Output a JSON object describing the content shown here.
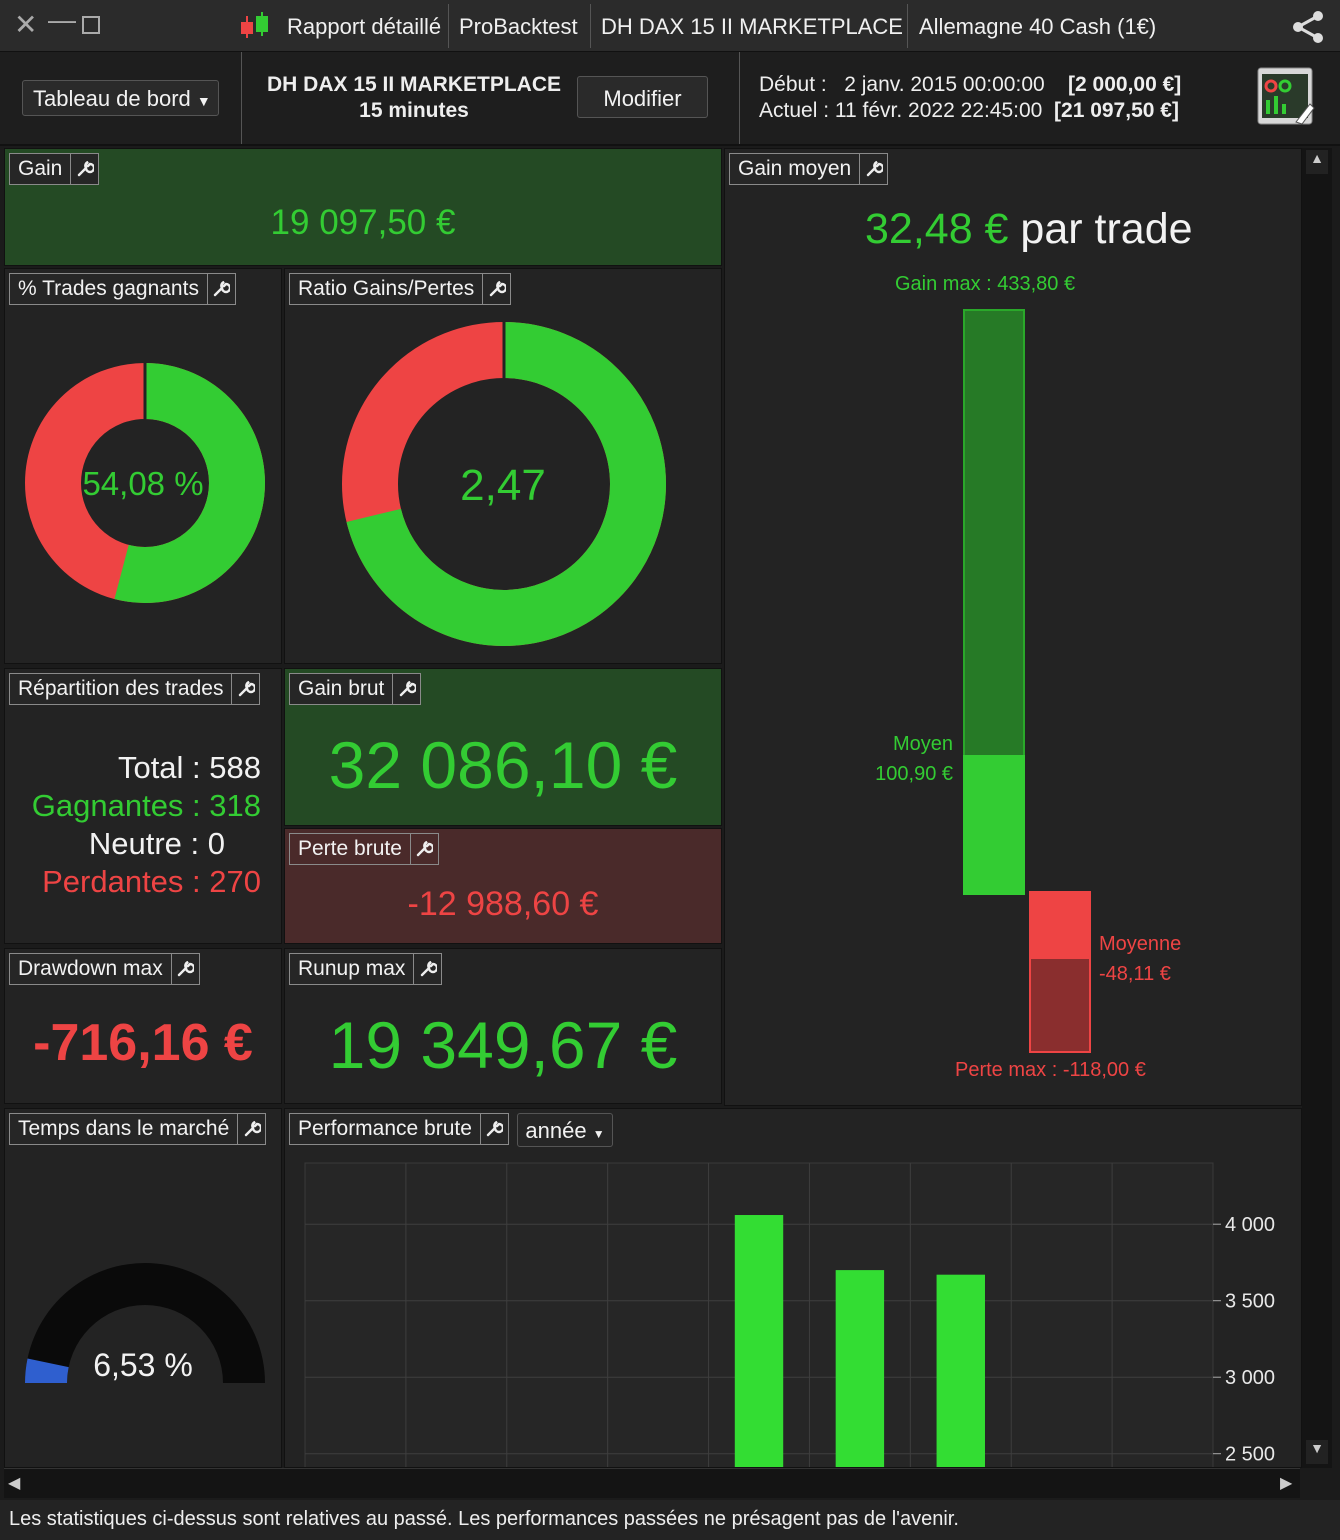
{
  "titlebar": {
    "close": "✕",
    "minimize": "—",
    "maximize": "☐",
    "tabs": [
      "Rapport détaillé",
      "ProBacktest",
      "DH DAX 15 II MARKETPLACE",
      "Allemagne 40 Cash (1€)"
    ]
  },
  "header": {
    "dashboard_select": "Tableau de bord",
    "strategy_name": "DH DAX 15 II MARKETPLACE",
    "timeframe": "15 minutes",
    "modify_label": "Modifier",
    "start_label": "Début :",
    "start_date": "2 janv. 2015 00:00:00",
    "start_capital": "[2 000,00 €]",
    "current_label": "Actuel :",
    "current_date": "11 févr. 2022 22:45:00",
    "current_capital": "[21 097,50 €]"
  },
  "panels": {
    "gain": {
      "title": "Gain",
      "value": "19 097,50 €"
    },
    "win_pct": {
      "title": "% Trades gagnants",
      "value": "54,08 %",
      "fraction": 0.5408
    },
    "ratio": {
      "title": "Ratio Gains/Pertes",
      "value": "2,47",
      "gain_fraction": 0.712
    },
    "avg_gain": {
      "title": "Gain moyen",
      "value": "32,48 €",
      "suffix": "par trade",
      "max_gain": "Gain max : 433,80 €",
      "avg_win_label": "Moyen",
      "avg_win_value": "100,90 €",
      "avg_loss_label": "Moyenne",
      "avg_loss_value": "-48,11 €",
      "max_loss": "Perte max : -118,00 €"
    },
    "distribution": {
      "title": "Répartition des trades",
      "total": "Total : 588",
      "winners": "Gagnantes : 318",
      "neutral": "Neutre : 0",
      "losers": "Perdantes : 270"
    },
    "gross_gain": {
      "title": "Gain brut",
      "value": "32 086,10 €"
    },
    "gross_loss": {
      "title": "Perte brute",
      "value": "-12 988,60 €"
    },
    "drawdown": {
      "title": "Drawdown max",
      "value": "-716,16 €"
    },
    "runup": {
      "title": "Runup max",
      "value": "19 349,67 €"
    },
    "time_in_market": {
      "title": "Temps dans le marché",
      "value": "6,53 %",
      "fraction": 0.0653
    },
    "performance": {
      "title": "Performance brute",
      "period_select": "année"
    }
  },
  "chart_data": {
    "type": "bar",
    "title": "Performance brute",
    "categories": [
      "",
      "",
      "",
      "",
      "",
      "",
      "",
      "",
      ""
    ],
    "values": [
      null,
      null,
      null,
      null,
      4060,
      3700,
      3670,
      null,
      null
    ],
    "ylim": [
      2400,
      4400
    ],
    "yticks": [
      "4 000",
      "3 500",
      "3 000",
      "2 500"
    ],
    "ytick_values": [
      4000,
      3500,
      3000,
      2500
    ],
    "grid": true,
    "color": "#33dd33"
  },
  "footer": {
    "disclaimer": "Les statistiques ci-dessus sont relatives au passé. Les performances passées ne présagent pas de l'avenir."
  },
  "colors": {
    "green": "#33cc33",
    "red": "#ee4444",
    "dark_green_bg": "#244a24",
    "dark_red_bg": "#4a2a2a",
    "blue": "#2f5fcf"
  }
}
